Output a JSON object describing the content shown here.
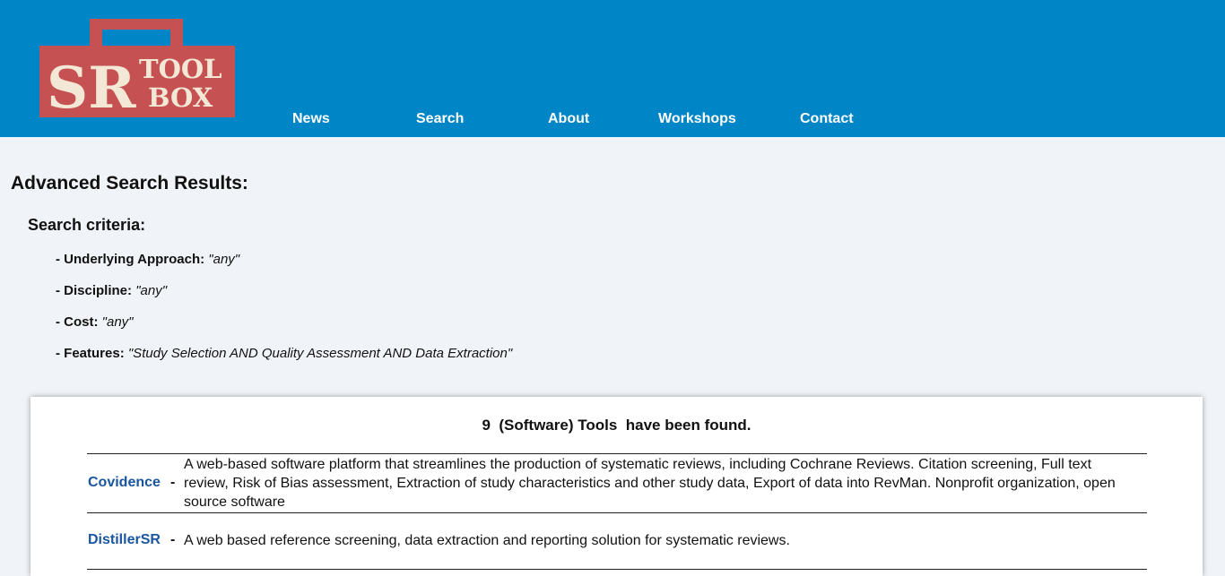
{
  "header": {
    "logo": {
      "text_sr": "SR",
      "text_tool": "TOOL",
      "text_box": "BOX",
      "bg_color": "#c65152",
      "text_color": "#f3e8d5"
    },
    "nav": [
      {
        "label": "News"
      },
      {
        "label": "Search"
      },
      {
        "label": "About"
      },
      {
        "label": "Workshops"
      },
      {
        "label": "Contact"
      }
    ]
  },
  "main": {
    "title": "Advanced Search Results:",
    "criteria_title": "Search criteria:",
    "criteria": [
      {
        "key": "- Underlying Approach:",
        "value": "\"any\""
      },
      {
        "key": "- Discipline:",
        "value": "\"any\""
      },
      {
        "key": "- Cost:",
        "value": "\"any\""
      },
      {
        "key": "- Features:",
        "value": "\"Study Selection AND Quality Assessment AND Data Extraction\""
      }
    ]
  },
  "results": {
    "found_text": "9  (Software) Tools  have been found.",
    "tools": [
      {
        "name": "Covidence",
        "dash": "-",
        "description": "A web-based software platform that streamlines the production of systematic reviews, including Cochrane Reviews. Citation screening, Full text review, Risk of Bias assessment, Extraction of study characteristics and other study data, Export of data into RevMan. Nonprofit organization, open source software"
      },
      {
        "name": "DistillerSR",
        "dash": "-",
        "description": "A web based reference screening, data extraction and reporting solution for systematic reviews."
      }
    ]
  },
  "colors": {
    "header_bg": "#0085c6",
    "page_bg": "#f0f3f7",
    "link": "#1a56a0"
  }
}
